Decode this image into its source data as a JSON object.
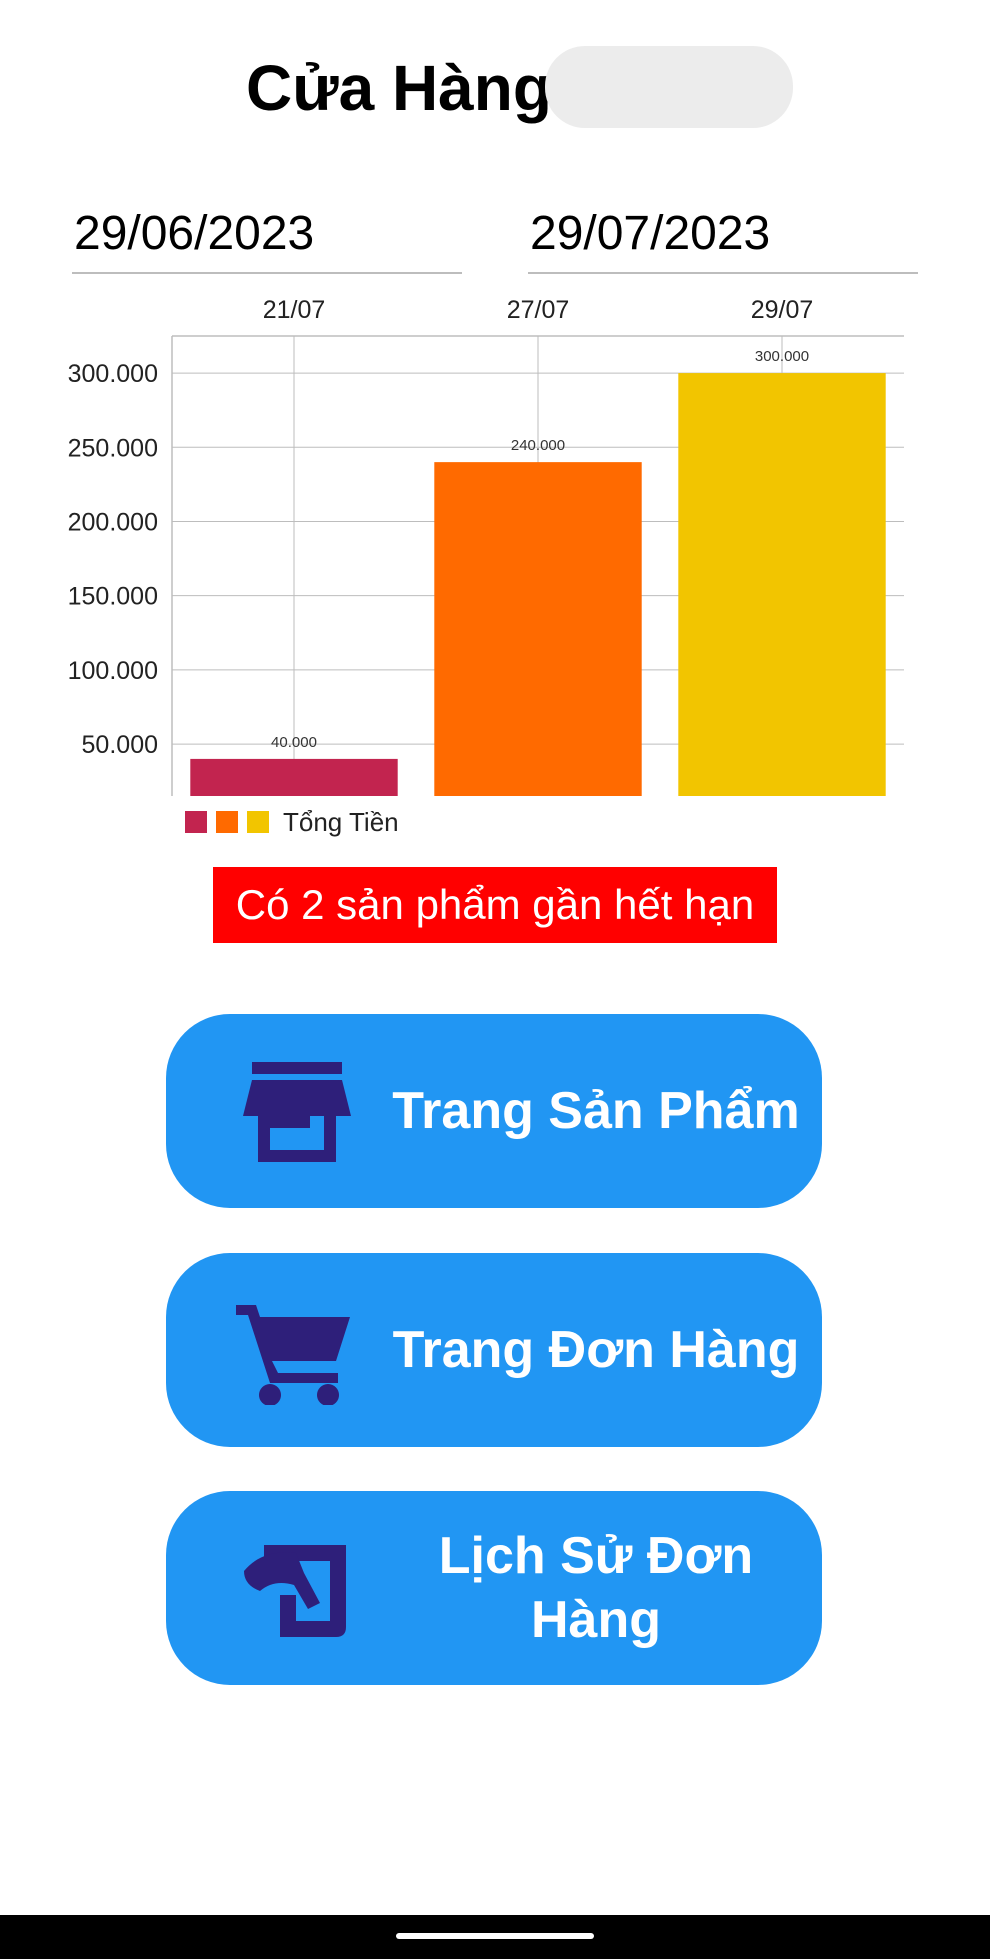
{
  "header": {
    "title": "Cửa Hàng"
  },
  "date_range": {
    "from": "29/06/2023",
    "to": "29/07/2023"
  },
  "chart_data": {
    "type": "bar",
    "categories": [
      "21/07",
      "27/07",
      "29/07"
    ],
    "values": [
      40000,
      240000,
      300000
    ],
    "value_labels": [
      "40.000",
      "240.000",
      "300.000"
    ],
    "y_ticks": [
      50000,
      100000,
      150000,
      200000,
      250000,
      300000
    ],
    "y_tick_labels": [
      "50.000",
      "100.000",
      "150.000",
      "200.000",
      "250.000",
      "300.000"
    ],
    "ylim": [
      15000,
      325000
    ],
    "bar_colors": [
      "#c2244f",
      "#ff6a00",
      "#f2c500"
    ],
    "grid": true,
    "x_axis_position": "top",
    "legend": {
      "label": "Tổng Tiền",
      "position": "bottom-left"
    }
  },
  "alert": {
    "text": "Có 2 sản phẩm gần hết hạn",
    "color": "#ff0000"
  },
  "menu": {
    "products_label": "Trang Sản Phẩm",
    "orders_label": "Trang Đơn Hàng",
    "history_label": "Lịch Sử Đơn Hàng"
  },
  "icons": {
    "products": "store-icon",
    "orders": "cart-icon",
    "history": "history-icon"
  },
  "colors": {
    "button_bg": "#2196f3",
    "icon_color": "#2e1f7a",
    "button_text": "#ffffff"
  }
}
